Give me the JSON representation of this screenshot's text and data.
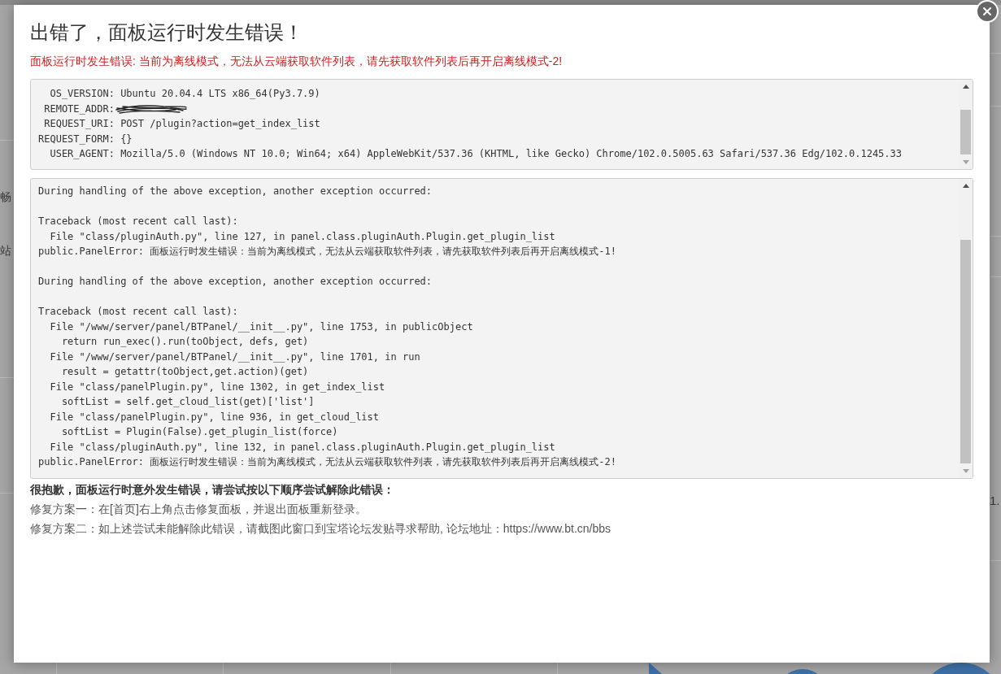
{
  "background": {
    "left_labels": [
      "畅",
      "站"
    ],
    "right_labels": [
      "1."
    ]
  },
  "dialog": {
    "title": "出错了，面板运行时发生错误！",
    "error_message": "面板运行时发生错误: 当前为离线模式，无法从云端获取软件列表，请先获取软件列表后再开启离线模式-2!",
    "request_info": [
      {
        "text": "  OS_VERSION: Ubuntu 20.04.4 LTS x86_64(Py3.7.9)",
        "redacted": false
      },
      {
        "text": " REMOTE_ADDR:",
        "redacted": true
      },
      {
        "text": " REQUEST_URI: POST /plugin?action=get_index_list",
        "redacted": false
      },
      {
        "text": "REQUEST_FORM: {}",
        "redacted": false
      },
      {
        "text": "  USER_AGENT: Mozilla/5.0 (Windows NT 10.0; Win64; x64) AppleWebKit/537.36 (KHTML, like Gecko) Chrome/102.0.5005.63 Safari/537.36 Edg/102.0.1245.33",
        "redacted": false
      }
    ],
    "traceback": [
      [
        "During handling of the above exception, another exception occurred:"
      ],
      [
        "Traceback (most recent call last):",
        "  File \"class/pluginAuth.py\", line 127, in panel.class.pluginAuth.Plugin.get_plugin_list",
        "public.PanelError: 面板运行时发生错误：当前为离线模式，无法从云端获取软件列表，请先获取软件列表后再开启离线模式-1!"
      ],
      [
        "During handling of the above exception, another exception occurred:"
      ],
      [
        "Traceback (most recent call last):",
        "  File \"/www/server/panel/BTPanel/__init__.py\", line 1753, in publicObject",
        "    return run_exec().run(toObject, defs, get)",
        "  File \"/www/server/panel/BTPanel/__init__.py\", line 1701, in run",
        "    result = getattr(toObject,get.action)(get)",
        "  File \"class/panelPlugin.py\", line 1302, in get_index_list",
        "    softList = self.get_cloud_list(get)['list']",
        "  File \"class/panelPlugin.py\", line 936, in get_cloud_list",
        "    softList = Plugin(False).get_plugin_list(force)",
        "  File \"class/pluginAuth.py\", line 132, in panel.class.pluginAuth.Plugin.get_plugin_list",
        "public.PanelError: 面板运行时发生错误：当前为离线模式，无法从云端获取软件列表，请先获取软件列表后再开启离线模式-2!"
      ]
    ],
    "help": {
      "heading": "很抱歉，面板运行时意外发生错误，请尝试按以下顺序尝试解除此错误：",
      "steps": [
        "修复方案一：在[首页]右上角点击修复面板，并退出面板重新登录。",
        "修复方案二：如上述尝试未能解除此错误，请截图此窗口到宝塔论坛发贴寻求帮助, 论坛地址：https://www.bt.cn/bbs"
      ]
    }
  }
}
